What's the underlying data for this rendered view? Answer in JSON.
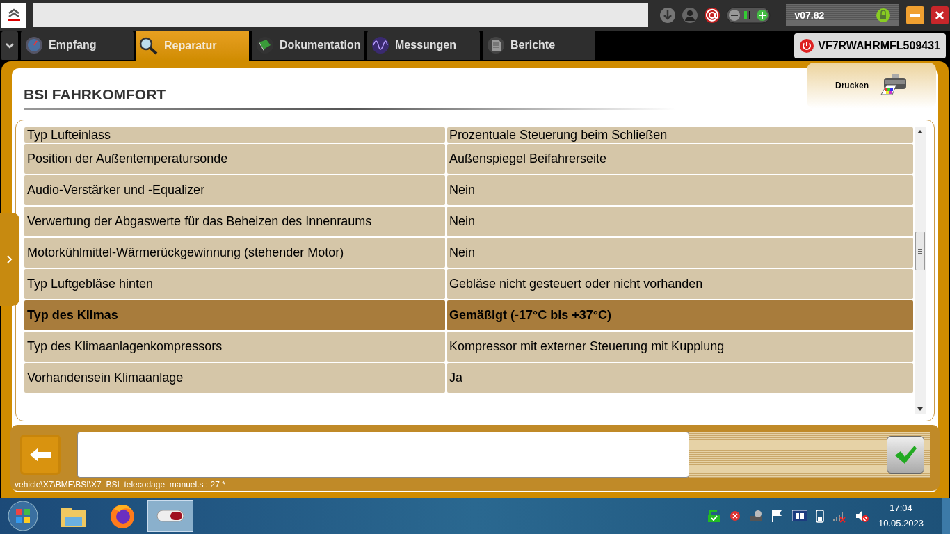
{
  "top_bar": {
    "version": "v07.82"
  },
  "tabs": [
    {
      "label": "Empfang",
      "selected": false
    },
    {
      "label": "Reparatur",
      "selected": true
    },
    {
      "label": "Dokumentation",
      "selected": false
    },
    {
      "label": "Messungen",
      "selected": false
    },
    {
      "label": "Berichte",
      "selected": false
    }
  ],
  "vin": "VF7RWAHRMFL509431",
  "page": {
    "title": "BSI FAHRKOMFORT",
    "print_label": "Drucken"
  },
  "table": {
    "rows": [
      {
        "name": "Typ Lufteinlass",
        "value": "Prozentuale Steuerung beim Schließen",
        "selected": false
      },
      {
        "name": "Position der Außentemperatursonde",
        "value": "Außenspiegel Beifahrerseite",
        "selected": false
      },
      {
        "name": "Audio-Verstärker und -Equalizer",
        "value": "Nein",
        "selected": false
      },
      {
        "name": "Verwertung der Abgaswerte für das Beheizen des Innenraums",
        "value": "Nein",
        "selected": false
      },
      {
        "name": "Motorkühlmittel-Wärmerückgewinnung (stehender Motor)",
        "value": "Nein",
        "selected": false
      },
      {
        "name": "Typ Luftgebläse hinten",
        "value": "Gebläse nicht gesteuert oder nicht vorhanden",
        "selected": false
      },
      {
        "name": "Typ des Klimas",
        "value": "Gemäßigt (-17°C bis +37°C)",
        "selected": true
      },
      {
        "name": "Typ des Klimaanlagenkompressors",
        "value": "Kompressor mit externer Steuerung mit Kupplung",
        "selected": false
      },
      {
        "name": "Vorhandensein Klimaanlage",
        "value": "Ja",
        "selected": false
      }
    ]
  },
  "status_path": "vehicle\\X7\\BMF\\BSI\\X7_BSI_telecodage_manuel.s : 27 *",
  "taskbar": {
    "time": "17:04",
    "date": "10.05.2023"
  }
}
